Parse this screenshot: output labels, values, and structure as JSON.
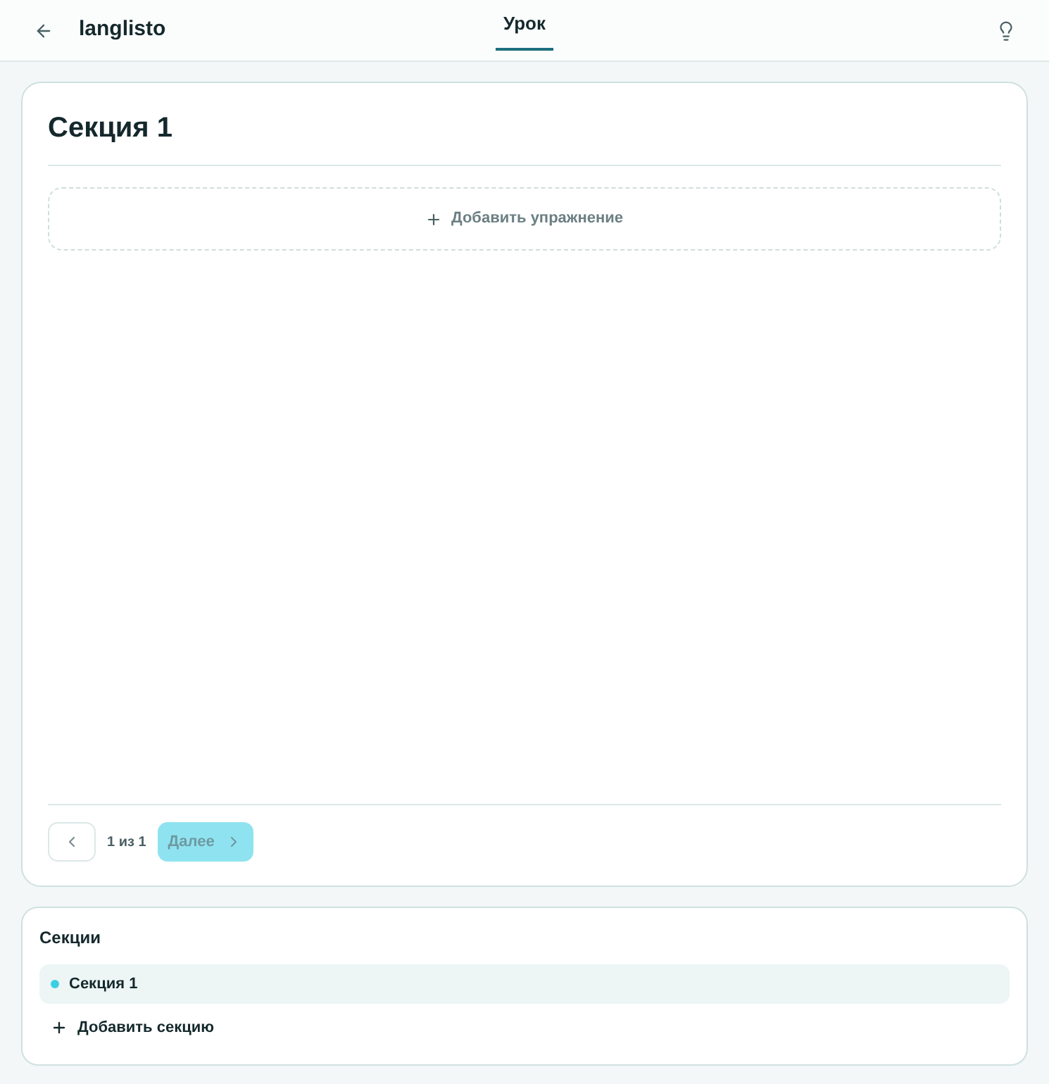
{
  "header": {
    "logo": "langlisto",
    "tabs": [
      {
        "label": "Урок",
        "selected": true
      }
    ]
  },
  "lesson": {
    "title": "Секция 1",
    "add_exercise": "Добавить упражнение",
    "pagination": {
      "page": "1 из 1",
      "next": "Далее",
      "next_disabled": true
    }
  },
  "sections_panel": {
    "title": "Секции",
    "items": [
      {
        "label": "Секция 1",
        "selected": true,
        "color": "#3ccfe3"
      }
    ],
    "add_section": "Добавить секцию"
  }
}
